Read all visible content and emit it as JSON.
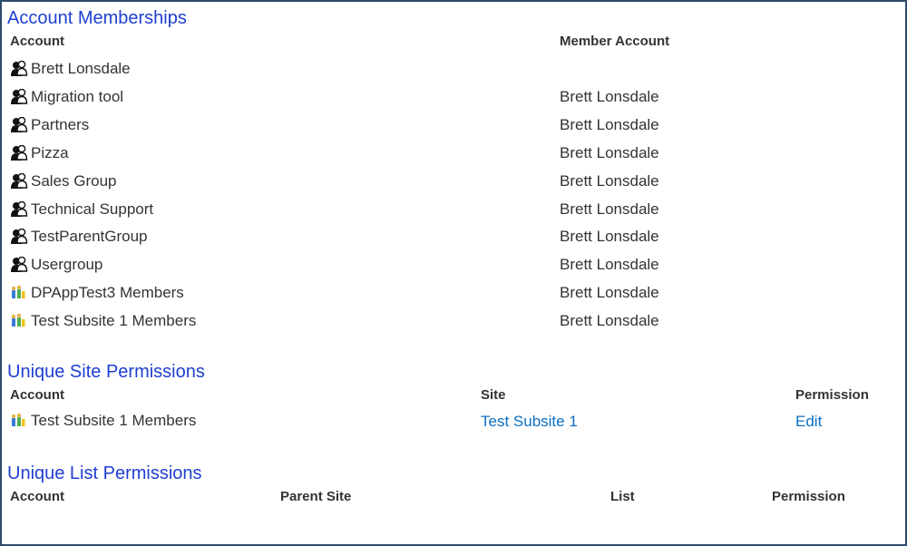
{
  "memberships": {
    "title": "Account Memberships",
    "col_account": "Account",
    "col_member": "Member Account",
    "rows": [
      {
        "account": "Brett Lonsdale",
        "member": "",
        "icon": "user-group-icon"
      },
      {
        "account": "Migration tool",
        "member": "Brett Lonsdale",
        "icon": "user-group-icon"
      },
      {
        "account": "Partners",
        "member": "Brett Lonsdale",
        "icon": "user-group-icon"
      },
      {
        "account": "Pizza",
        "member": "Brett Lonsdale",
        "icon": "user-group-icon"
      },
      {
        "account": "Sales Group",
        "member": "Brett Lonsdale",
        "icon": "user-group-icon"
      },
      {
        "account": "Technical Support",
        "member": "Brett Lonsdale",
        "icon": "user-group-icon"
      },
      {
        "account": "TestParentGroup",
        "member": "Brett Lonsdale",
        "icon": "user-group-icon"
      },
      {
        "account": "Usergroup",
        "member": "Brett Lonsdale",
        "icon": "user-group-icon"
      },
      {
        "account": "DPAppTest3 Members",
        "member": "Brett Lonsdale",
        "icon": "sharepoint-group-icon"
      },
      {
        "account": "Test Subsite 1 Members",
        "member": "Brett Lonsdale",
        "icon": "sharepoint-group-icon"
      }
    ]
  },
  "site_permissions": {
    "title": "Unique Site Permissions",
    "col_account": "Account",
    "col_site": "Site",
    "col_permission": "Permission",
    "rows": [
      {
        "account": "Test Subsite 1 Members",
        "site": "Test Subsite 1",
        "permission": "Edit",
        "icon": "sharepoint-group-icon"
      }
    ]
  },
  "list_permissions": {
    "title": "Unique List Permissions",
    "col_account": "Account",
    "col_parent_site": "Parent Site",
    "col_list": "List",
    "col_permission": "Permission"
  },
  "colors": {
    "section_title": "#1f3fd1",
    "link": "#0a6fc2",
    "frame_border": "#2e4a6e"
  }
}
